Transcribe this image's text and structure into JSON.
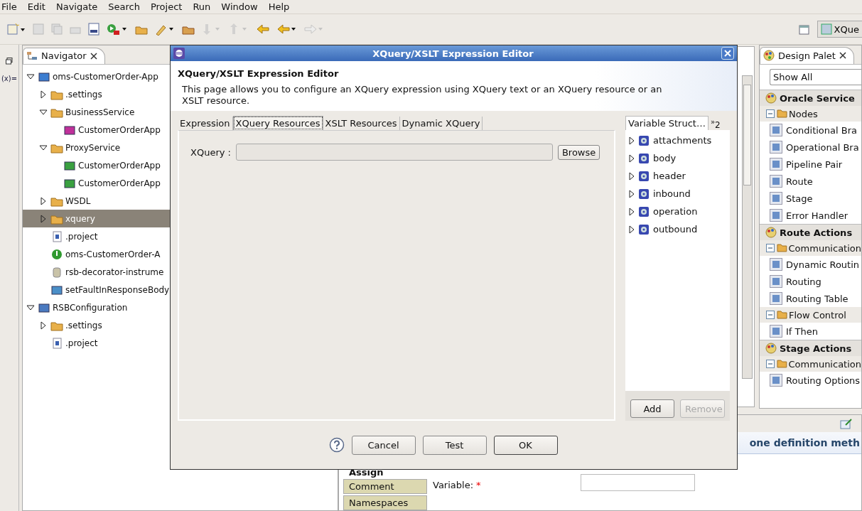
{
  "menu": [
    "File",
    "Edit",
    "Navigate",
    "Search",
    "Project",
    "Run",
    "Window",
    "Help"
  ],
  "perspective": "XQue",
  "side_strip": {
    "variables": "(x)="
  },
  "navigator": {
    "title": "Navigator",
    "items": [
      {
        "label": "oms-CustomerOrder-App",
        "kind": "project",
        "expanded": true,
        "selected": false,
        "children": [
          {
            "label": ".settings",
            "kind": "folder",
            "expanded": false,
            "selected": false
          },
          {
            "label": "BusinessService",
            "kind": "folder",
            "expanded": true,
            "selected": false,
            "children": [
              {
                "label": "CustomerOrderApp",
                "kind": "business",
                "selected": false
              }
            ]
          },
          {
            "label": "ProxyService",
            "kind": "folder",
            "expanded": true,
            "selected": false,
            "children": [
              {
                "label": "CustomerOrderApp",
                "kind": "proxy",
                "selected": false
              },
              {
                "label": "CustomerOrderApp",
                "kind": "proxy",
                "selected": false
              }
            ]
          },
          {
            "label": "WSDL",
            "kind": "folder",
            "expanded": false,
            "selected": false
          },
          {
            "label": "xquery",
            "kind": "folder",
            "expanded": false,
            "selected": true
          },
          {
            "label": ".project",
            "kind": "xml",
            "selected": false
          },
          {
            "label": "oms-CustomerOrder-A",
            "kind": "warning",
            "selected": false
          },
          {
            "label": "rsb-decorator-instrume",
            "kind": "jar",
            "selected": false
          },
          {
            "label": "setFaultInResponseBody",
            "kind": "xquery",
            "selected": false
          }
        ]
      },
      {
        "label": "RSBConfiguration",
        "kind": "config",
        "expanded": true,
        "selected": false,
        "children": [
          {
            "label": ".settings",
            "kind": "folder",
            "expanded": false,
            "selected": false
          },
          {
            "label": ".project",
            "kind": "xml",
            "selected": false
          }
        ]
      }
    ]
  },
  "palette": {
    "title": "Design Palet",
    "filter": "Show All",
    "groups": [
      {
        "title": "Oracle Service",
        "sections": [
          {
            "title": "Nodes",
            "items": [
              "Conditional Bra",
              "Operational Bra",
              "Pipeline Pair",
              "Route",
              "Stage",
              "Error Handler"
            ]
          }
        ]
      },
      {
        "title": "Route Actions",
        "sections": [
          {
            "title": "Communication",
            "items": [
              "Dynamic Routin",
              "Routing",
              "Routing Table"
            ]
          },
          {
            "title": "Flow Control",
            "items": [
              "If Then"
            ]
          }
        ]
      },
      {
        "title": "Stage Actions",
        "sections": [
          {
            "title": "Communication",
            "items": [
              "Routing Options"
            ]
          }
        ]
      }
    ]
  },
  "properties": {
    "heading": "one definition meth",
    "section": "Assign",
    "tabs": [
      "Comment",
      "Namespaces"
    ],
    "field_label": "Variable:",
    "required_mark": "*"
  },
  "dialog": {
    "title": "XQuery/XSLT Expression Editor",
    "heading": "XQuery/XSLT Expression Editor",
    "description": "This page allows you to configure an XQuery expression using XQuery text or an XQuery resource or an XSLT resource.",
    "tabs": [
      {
        "label": "Expression",
        "selected": false
      },
      {
        "label": "XQuery Resources",
        "selected": true
      },
      {
        "label": "XSLT Resources",
        "selected": false
      },
      {
        "label": "Dynamic XQuery",
        "selected": false
      }
    ],
    "xquery_label": "XQuery :",
    "browse": "Browse",
    "variables": {
      "tab": "Variable Struct…",
      "overflow": "$^{»}$2",
      "items": [
        "attachments",
        "body",
        "header",
        "inbound",
        "operation",
        "outbound"
      ]
    },
    "add": "Add",
    "remove": {
      "label": "Remove",
      "disabled": true
    },
    "buttons": [
      "Cancel",
      "Test",
      "OK"
    ]
  }
}
